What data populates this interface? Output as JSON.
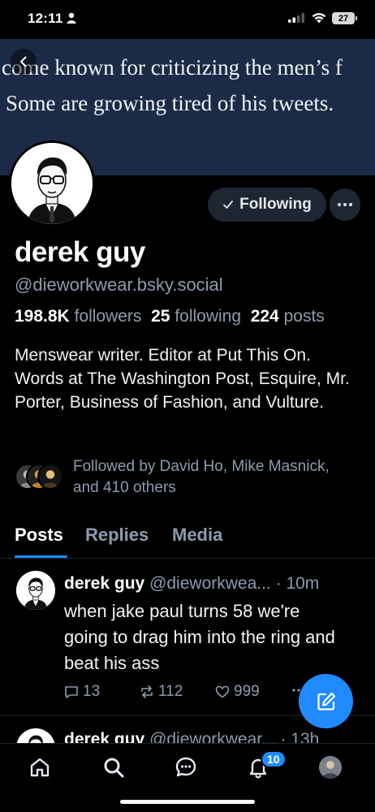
{
  "status_bar": {
    "time": "12:11",
    "battery": "27"
  },
  "banner": {
    "line1": "come known for criticizing the men’s f",
    "line2": "Some are growing tired of his tweets."
  },
  "profile": {
    "display_name": "derek guy",
    "handle": "@dieworkwear.bsky.social",
    "followers_count": "198.8K",
    "followers_label": "followers",
    "following_count": "25",
    "following_label": "following",
    "posts_count": "224",
    "posts_label": "posts",
    "bio": "Menswear writer. Editor at Put This On. Words at The Washington Post, Esquire, Mr. Porter, Business of Fashion, and Vulture.",
    "followed_by": "Followed by David Ho, Mike Masnick, and 410 others"
  },
  "actions": {
    "following_label": "Following",
    "more_label": "···"
  },
  "tabs": [
    {
      "label": "Posts",
      "active": true
    },
    {
      "label": "Replies",
      "active": false
    },
    {
      "label": "Media",
      "active": false
    }
  ],
  "posts": [
    {
      "author": "derek guy",
      "handle": "@dieworkwea...",
      "time": "· 10m",
      "text": "when jake paul turns 58 we're going to drag him into the ring and beat his ass",
      "replies": "13",
      "reposts": "112",
      "likes": "999"
    },
    {
      "author": "derek guy",
      "handle": "@dieworkwear...",
      "time": "· 13h"
    }
  ],
  "nav": {
    "notification_count": "10"
  },
  "colors": {
    "accent": "#208bfe",
    "background": "#000000",
    "muted": "#8e9bad",
    "banner": "#1b2b47"
  },
  "icons": [
    "person-icon",
    "signal-icon",
    "wifi-icon",
    "chevron-left-icon",
    "check-icon",
    "ellipsis-icon",
    "comment-icon",
    "repost-icon",
    "heart-icon",
    "compose-icon",
    "home-icon",
    "search-icon",
    "chat-icon",
    "bell-icon"
  ]
}
